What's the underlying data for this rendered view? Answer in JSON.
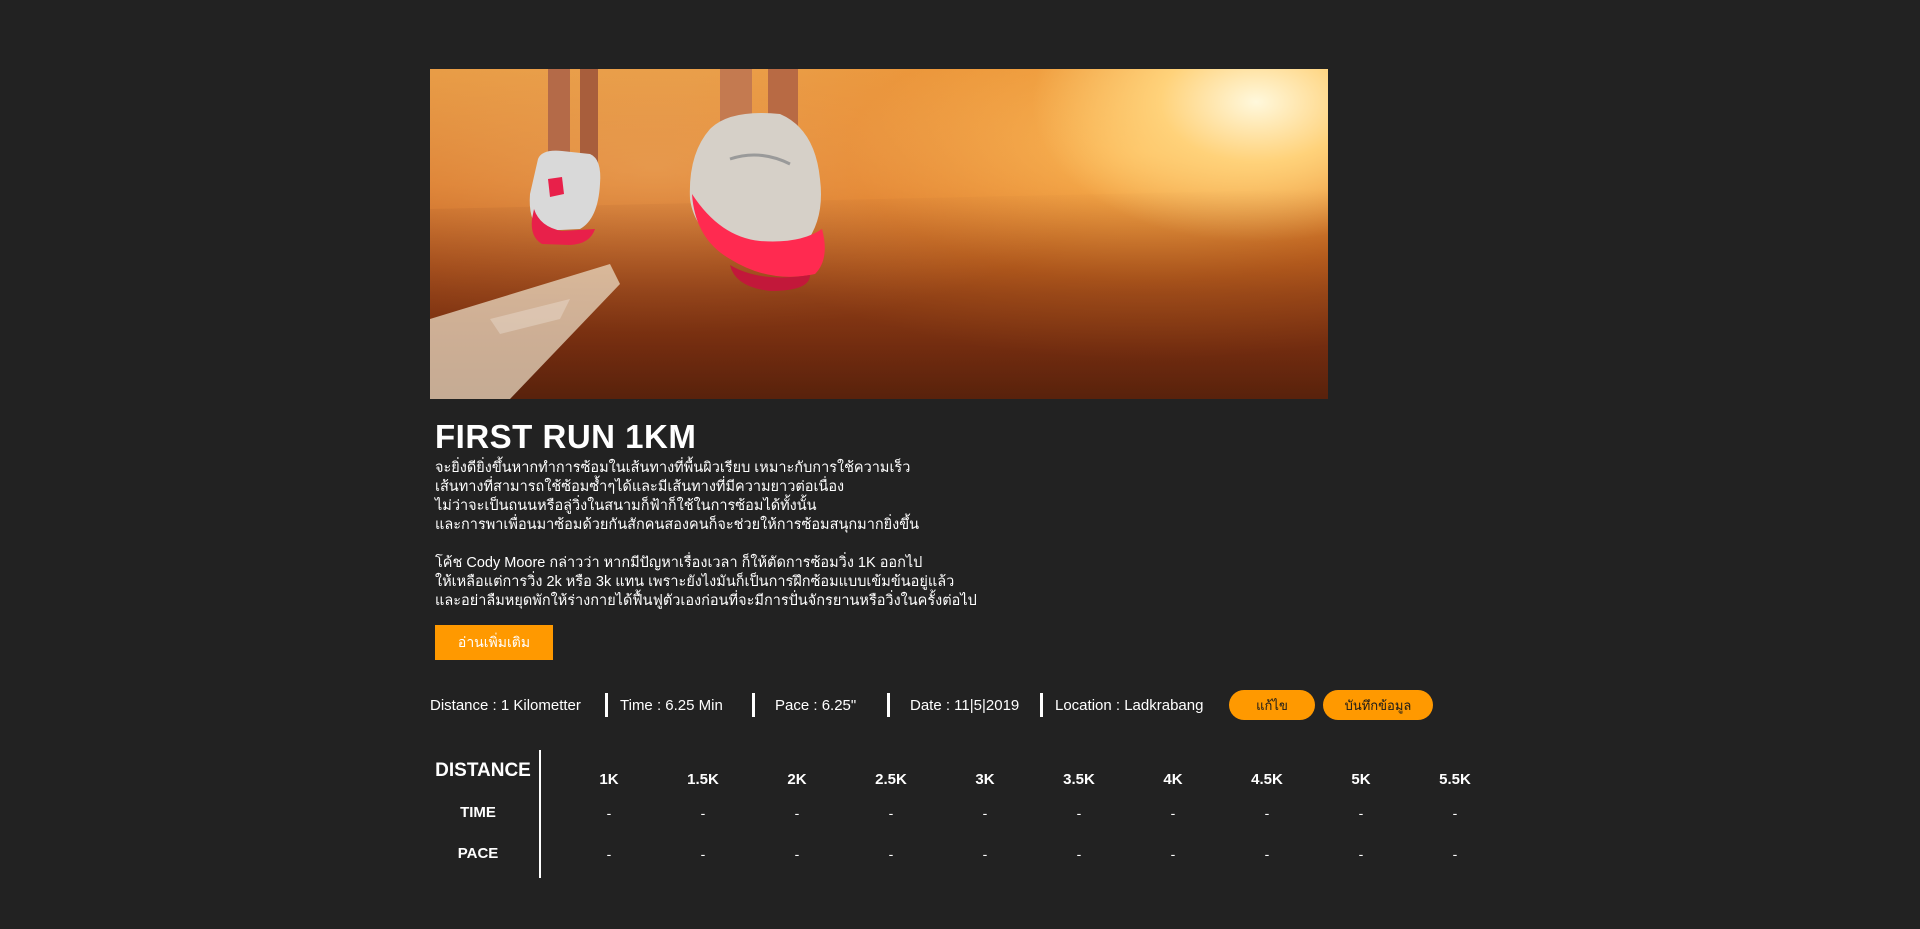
{
  "hero": {
    "image_alt": "runner-feet-on-track-at-sunset"
  },
  "post": {
    "title": "FIRST RUN 1KM",
    "paragraph1": [
      "จะยิ่งดียิ่งขึ้นหากทำการซ้อมในเส้นทางที่พื้นผิวเรียบ เหมาะกับการใช้ความเร็ว",
      "เส้นทางที่สามารถใช้ซ้อมซ้ำๆได้และมีเส้นทางที่มีความยาวต่อเนื่อง",
      "ไม่ว่าจะเป็นถนนหรือลู่วิ่งในสนามก็ฟ้าก็ใช้ในการซ้อมได้ทั้งนั้น",
      "และการพาเพื่อนมาซ้อมด้วยกันสักคนสองคนก็จะช่วยให้การซ้อมสนุกมากยิ่งขึ้น"
    ],
    "paragraph2": [
      "โค้ช Cody Moore กล่าวว่า หากมีปัญหาเรื่องเวลา ก็ให้ตัดการซ้อมวิ่ง 1K ออกไป",
      "ให้เหลือแต่การวิ่ง 2k หรือ 3k แทน เพราะยังไงมันก็เป็นการฝึกซ้อมแบบเข้มข้นอยู่แล้ว",
      "และอย่าลืมหยุดพักให้ร่างกายได้ฟื้นฟูตัวเองก่อนที่จะมีการปั่นจักรยานหรือวิ่งในครั้งต่อไป"
    ],
    "read_more_label": "อ่านเพิ่มเติม"
  },
  "stats": {
    "distance": "Distance : 1 Kilometter",
    "time": "Time :  6.25 Min",
    "pace": "Pace :  6.25\"",
    "date": "Date :  11|5|2019",
    "location": "Location : Ladkrabang",
    "edit_label": "แก้ไข",
    "save_label": "บันทึกข้อมูล"
  },
  "splits": {
    "distance_label": "DISTANCE",
    "time_label": "TIME",
    "pace_label": "PACE",
    "columns": [
      "1K",
      "1.5K",
      "2K",
      "2.5K",
      "3K",
      "3.5K",
      "4K",
      "4.5K",
      "5K",
      "5.5K"
    ],
    "time_values": [
      "-",
      "-",
      "-",
      "-",
      "-",
      "-",
      "-",
      "-",
      "-",
      "-"
    ],
    "pace_values": [
      "-",
      "-",
      "-",
      "-",
      "-",
      "-",
      "-",
      "-",
      "-",
      "-"
    ]
  },
  "colors": {
    "background": "#222222",
    "accent": "#ff9900",
    "text": "#ffffff"
  }
}
